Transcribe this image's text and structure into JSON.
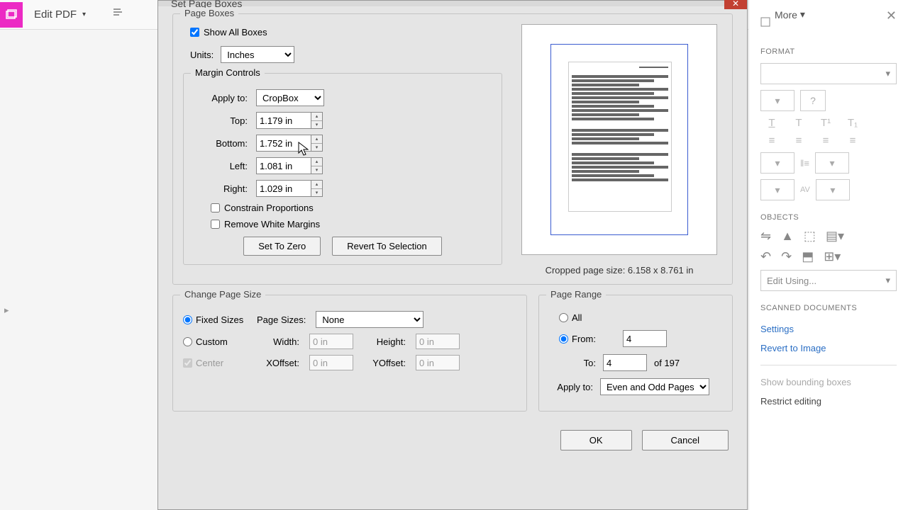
{
  "toolbar": {
    "edit_pdf": "Edit PDF",
    "more": "More"
  },
  "right_panel": {
    "format_heading": "FORMAT",
    "help_symbol": "?",
    "objects_heading": "OBJECTS",
    "edit_using": "Edit Using...",
    "scanned_heading": "SCANNED DOCUMENTS",
    "settings": "Settings",
    "revert": "Revert to Image",
    "show_bounding": "Show bounding boxes",
    "restrict": "Restrict editing"
  },
  "dialog": {
    "title": "Set Page Boxes",
    "page_boxes_label": "Page Boxes",
    "show_all_boxes": "Show All Boxes",
    "units_label": "Units:",
    "units_value": "Inches",
    "margin_controls_label": "Margin Controls",
    "apply_to_label": "Apply to:",
    "apply_to_value": "CropBox",
    "top_label": "Top:",
    "top_value": "1.179 in",
    "bottom_label": "Bottom:",
    "bottom_value": "1.752 in",
    "left_label": "Left:",
    "left_value": "1.081 in",
    "right_label": "Right:",
    "right_value": "1.029 in",
    "constrain": "Constrain Proportions",
    "remove_white": "Remove White Margins",
    "set_zero": "Set To Zero",
    "revert_sel": "Revert To Selection",
    "cropped_size": "Cropped page size: 6.158 x 8.761 in",
    "change_page_size_label": "Change Page Size",
    "fixed_sizes": "Fixed Sizes",
    "page_sizes_label": "Page Sizes:",
    "page_sizes_value": "None",
    "custom": "Custom",
    "width_label": "Width:",
    "width_value": "0 in",
    "height_label": "Height:",
    "height_value": "0 in",
    "center": "Center",
    "xoffset_label": "XOffset:",
    "xoffset_value": "0 in",
    "yoffset_label": "YOffset:",
    "yoffset_value": "0 in",
    "page_range_label": "Page Range",
    "all": "All",
    "from_label": "From:",
    "from_value": "4",
    "to_label": "To:",
    "to_value": "4",
    "of_total": "of 197",
    "pr_apply_to_label": "Apply to:",
    "pr_apply_to_value": "Even and Odd Pages",
    "ok": "OK",
    "cancel": "Cancel"
  }
}
